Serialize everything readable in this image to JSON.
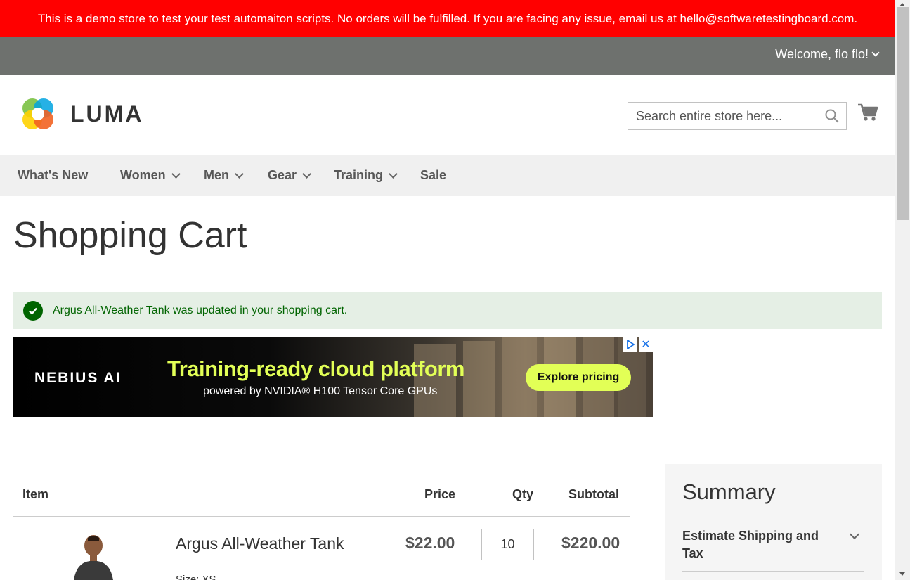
{
  "demo_banner": "This is a demo store to test your test automaiton scripts. No orders will be fulfilled. If you are facing any issue, email us at hello@softwaretestingboard.com.",
  "header": {
    "welcome": "Welcome, flo flo!",
    "logo_text": "LUMA",
    "search_placeholder": "Search entire store here..."
  },
  "nav": [
    {
      "label": "What's New",
      "has_dropdown": false
    },
    {
      "label": "Women",
      "has_dropdown": true
    },
    {
      "label": "Men",
      "has_dropdown": true
    },
    {
      "label": "Gear",
      "has_dropdown": true
    },
    {
      "label": "Training",
      "has_dropdown": true
    },
    {
      "label": "Sale",
      "has_dropdown": false
    }
  ],
  "page_title": "Shopping Cart",
  "message": "Argus All-Weather Tank was updated in your shopping cart.",
  "ad": {
    "brand": "NEBIUS AI",
    "headline": "Training-ready cloud platform",
    "subline": "powered by NVIDIA® H100 Tensor Core GPUs",
    "cta": "Explore pricing",
    "close": "✕"
  },
  "cart": {
    "columns": {
      "item": "Item",
      "price": "Price",
      "qty": "Qty",
      "subtotal": "Subtotal"
    },
    "items": [
      {
        "name": "Argus All-Weather Tank",
        "price": "$22.00",
        "qty": "10",
        "subtotal": "$220.00",
        "option": "Size: XS"
      }
    ]
  },
  "summary": {
    "title": "Summary",
    "estimate_shipping": "Estimate Shipping and Tax"
  },
  "colors": {
    "banner": "#ff0000",
    "welcome_bar": "#6e716e",
    "nav_bg": "#f0f0f0",
    "success_bg": "#e5efe5",
    "success_text": "#006400",
    "ad_accent": "#e2ff56"
  }
}
